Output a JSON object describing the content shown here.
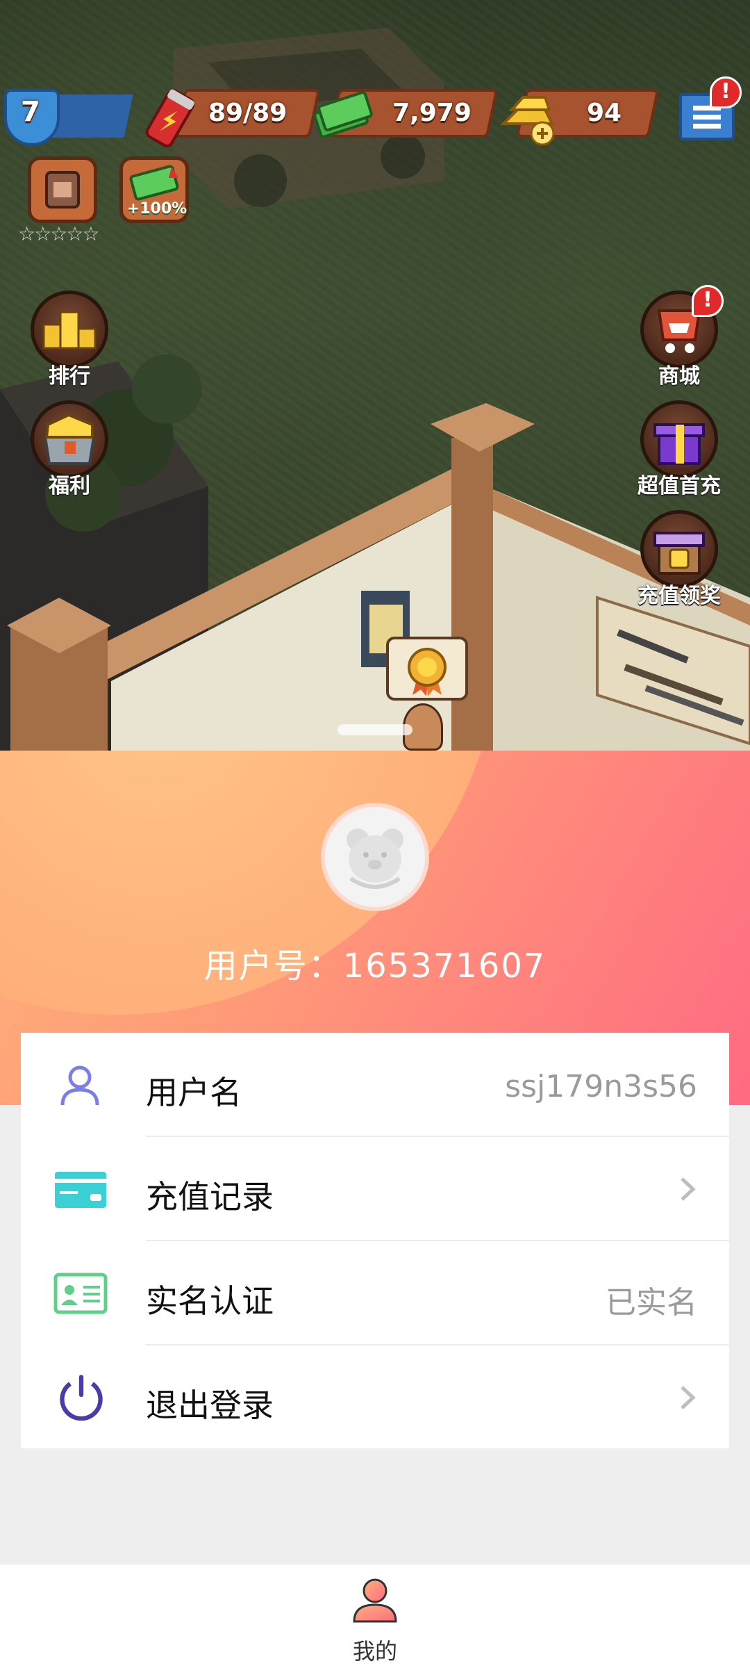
{
  "game": {
    "level": "7",
    "energy": "89/89",
    "cash": "7,979",
    "gold": "94",
    "alert_mark": "!",
    "stars": "☆☆☆☆☆",
    "boost_badge": "+100%",
    "left_buttons": [
      {
        "label": "排行"
      },
      {
        "label": "福利"
      }
    ],
    "right_buttons": [
      {
        "label": "商城"
      },
      {
        "label": "超值首充"
      },
      {
        "label": "充值领奖"
      }
    ]
  },
  "profile": {
    "user_id_text": "用户号：165371607",
    "rows": [
      {
        "label": "用户名",
        "value": "ssj179n3s56",
        "icon": "user-icon"
      },
      {
        "label": "充值记录",
        "value": "",
        "icon": "card-icon"
      },
      {
        "label": "实名认证",
        "value": "已实名",
        "icon": "id-card-icon"
      },
      {
        "label": "退出登录",
        "value": "",
        "icon": "power-icon"
      }
    ]
  },
  "tabbar": {
    "tabs": [
      {
        "label": "我的",
        "icon": "profile-tab-icon"
      }
    ]
  },
  "colors": {
    "accent_gradient_start": "#ffb27a",
    "accent_gradient_end": "#ff6b82",
    "user_icon": "#7b7ee8",
    "card_icon": "#3ad0d6",
    "id_icon": "#5fcf8a",
    "power_icon": "#4a3ca8"
  }
}
